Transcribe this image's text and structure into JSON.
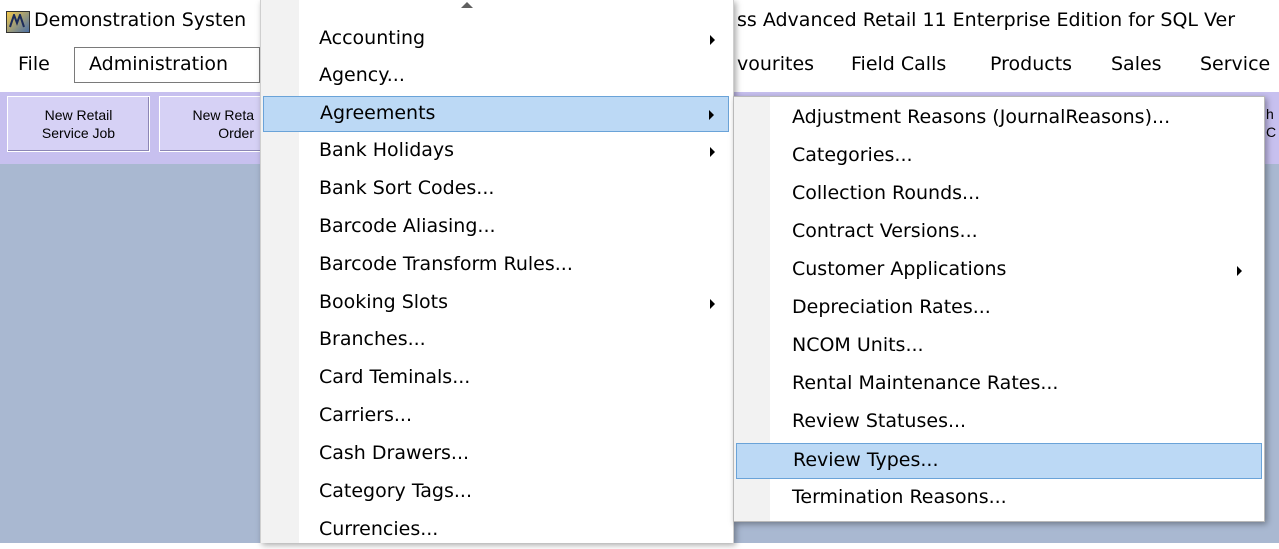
{
  "window": {
    "title_left": "Demonstration Systen",
    "title_right": "ss Advanced Retail 11 Enterprise Edition for SQL Ver"
  },
  "menubar": {
    "file": "File",
    "administration": "Administration",
    "favourites": "vourites",
    "field_calls": "Field Calls",
    "products": "Products",
    "sales": "Sales",
    "service": "Service"
  },
  "toolbar": {
    "buttons": [
      {
        "line1": "New Retail",
        "line2": "Service Job"
      },
      {
        "line1": "New Reta",
        "line2": "Order"
      }
    ],
    "edge_fragments": [
      "h",
      "C"
    ]
  },
  "admin_menu": {
    "items": [
      {
        "label": "Accounting",
        "submenu": true
      },
      {
        "label": "Agency...",
        "submenu": false
      },
      {
        "label": "Agreements",
        "submenu": true,
        "selected": true
      },
      {
        "label": "Bank Holidays",
        "submenu": true
      },
      {
        "label": "Bank Sort Codes...",
        "submenu": false
      },
      {
        "label": "Barcode Aliasing...",
        "submenu": false
      },
      {
        "label": "Barcode Transform Rules...",
        "submenu": false
      },
      {
        "label": "Booking Slots",
        "submenu": true
      },
      {
        "label": "Branches...",
        "submenu": false
      },
      {
        "label": "Card Teminals...",
        "submenu": false
      },
      {
        "label": "Carriers...",
        "submenu": false
      },
      {
        "label": "Cash Drawers...",
        "submenu": false
      },
      {
        "label": "Category Tags...",
        "submenu": false
      },
      {
        "label": "Currencies...",
        "submenu": false
      }
    ]
  },
  "agreements_menu": {
    "items": [
      {
        "label": "Adjustment Reasons (JournalReasons)...",
        "submenu": false
      },
      {
        "label": "Categories...",
        "submenu": false
      },
      {
        "label": "Collection Rounds...",
        "submenu": false
      },
      {
        "label": "Contract Versions...",
        "submenu": false
      },
      {
        "label": "Customer Applications",
        "submenu": true
      },
      {
        "label": "Depreciation Rates...",
        "submenu": false
      },
      {
        "label": "NCOM Units...",
        "submenu": false
      },
      {
        "label": "Rental Maintenance Rates...",
        "submenu": false
      },
      {
        "label": "Review Statuses...",
        "submenu": false
      },
      {
        "label": "Review Types...",
        "submenu": false,
        "selected": true
      },
      {
        "label": "Termination Reasons...",
        "submenu": false
      }
    ]
  },
  "colors": {
    "toolbar_bg": "#c7c0ef",
    "workspace_bg": "#a9b8d1",
    "highlight": "#bcd9f5",
    "highlight_border": "#6aa3d8"
  }
}
